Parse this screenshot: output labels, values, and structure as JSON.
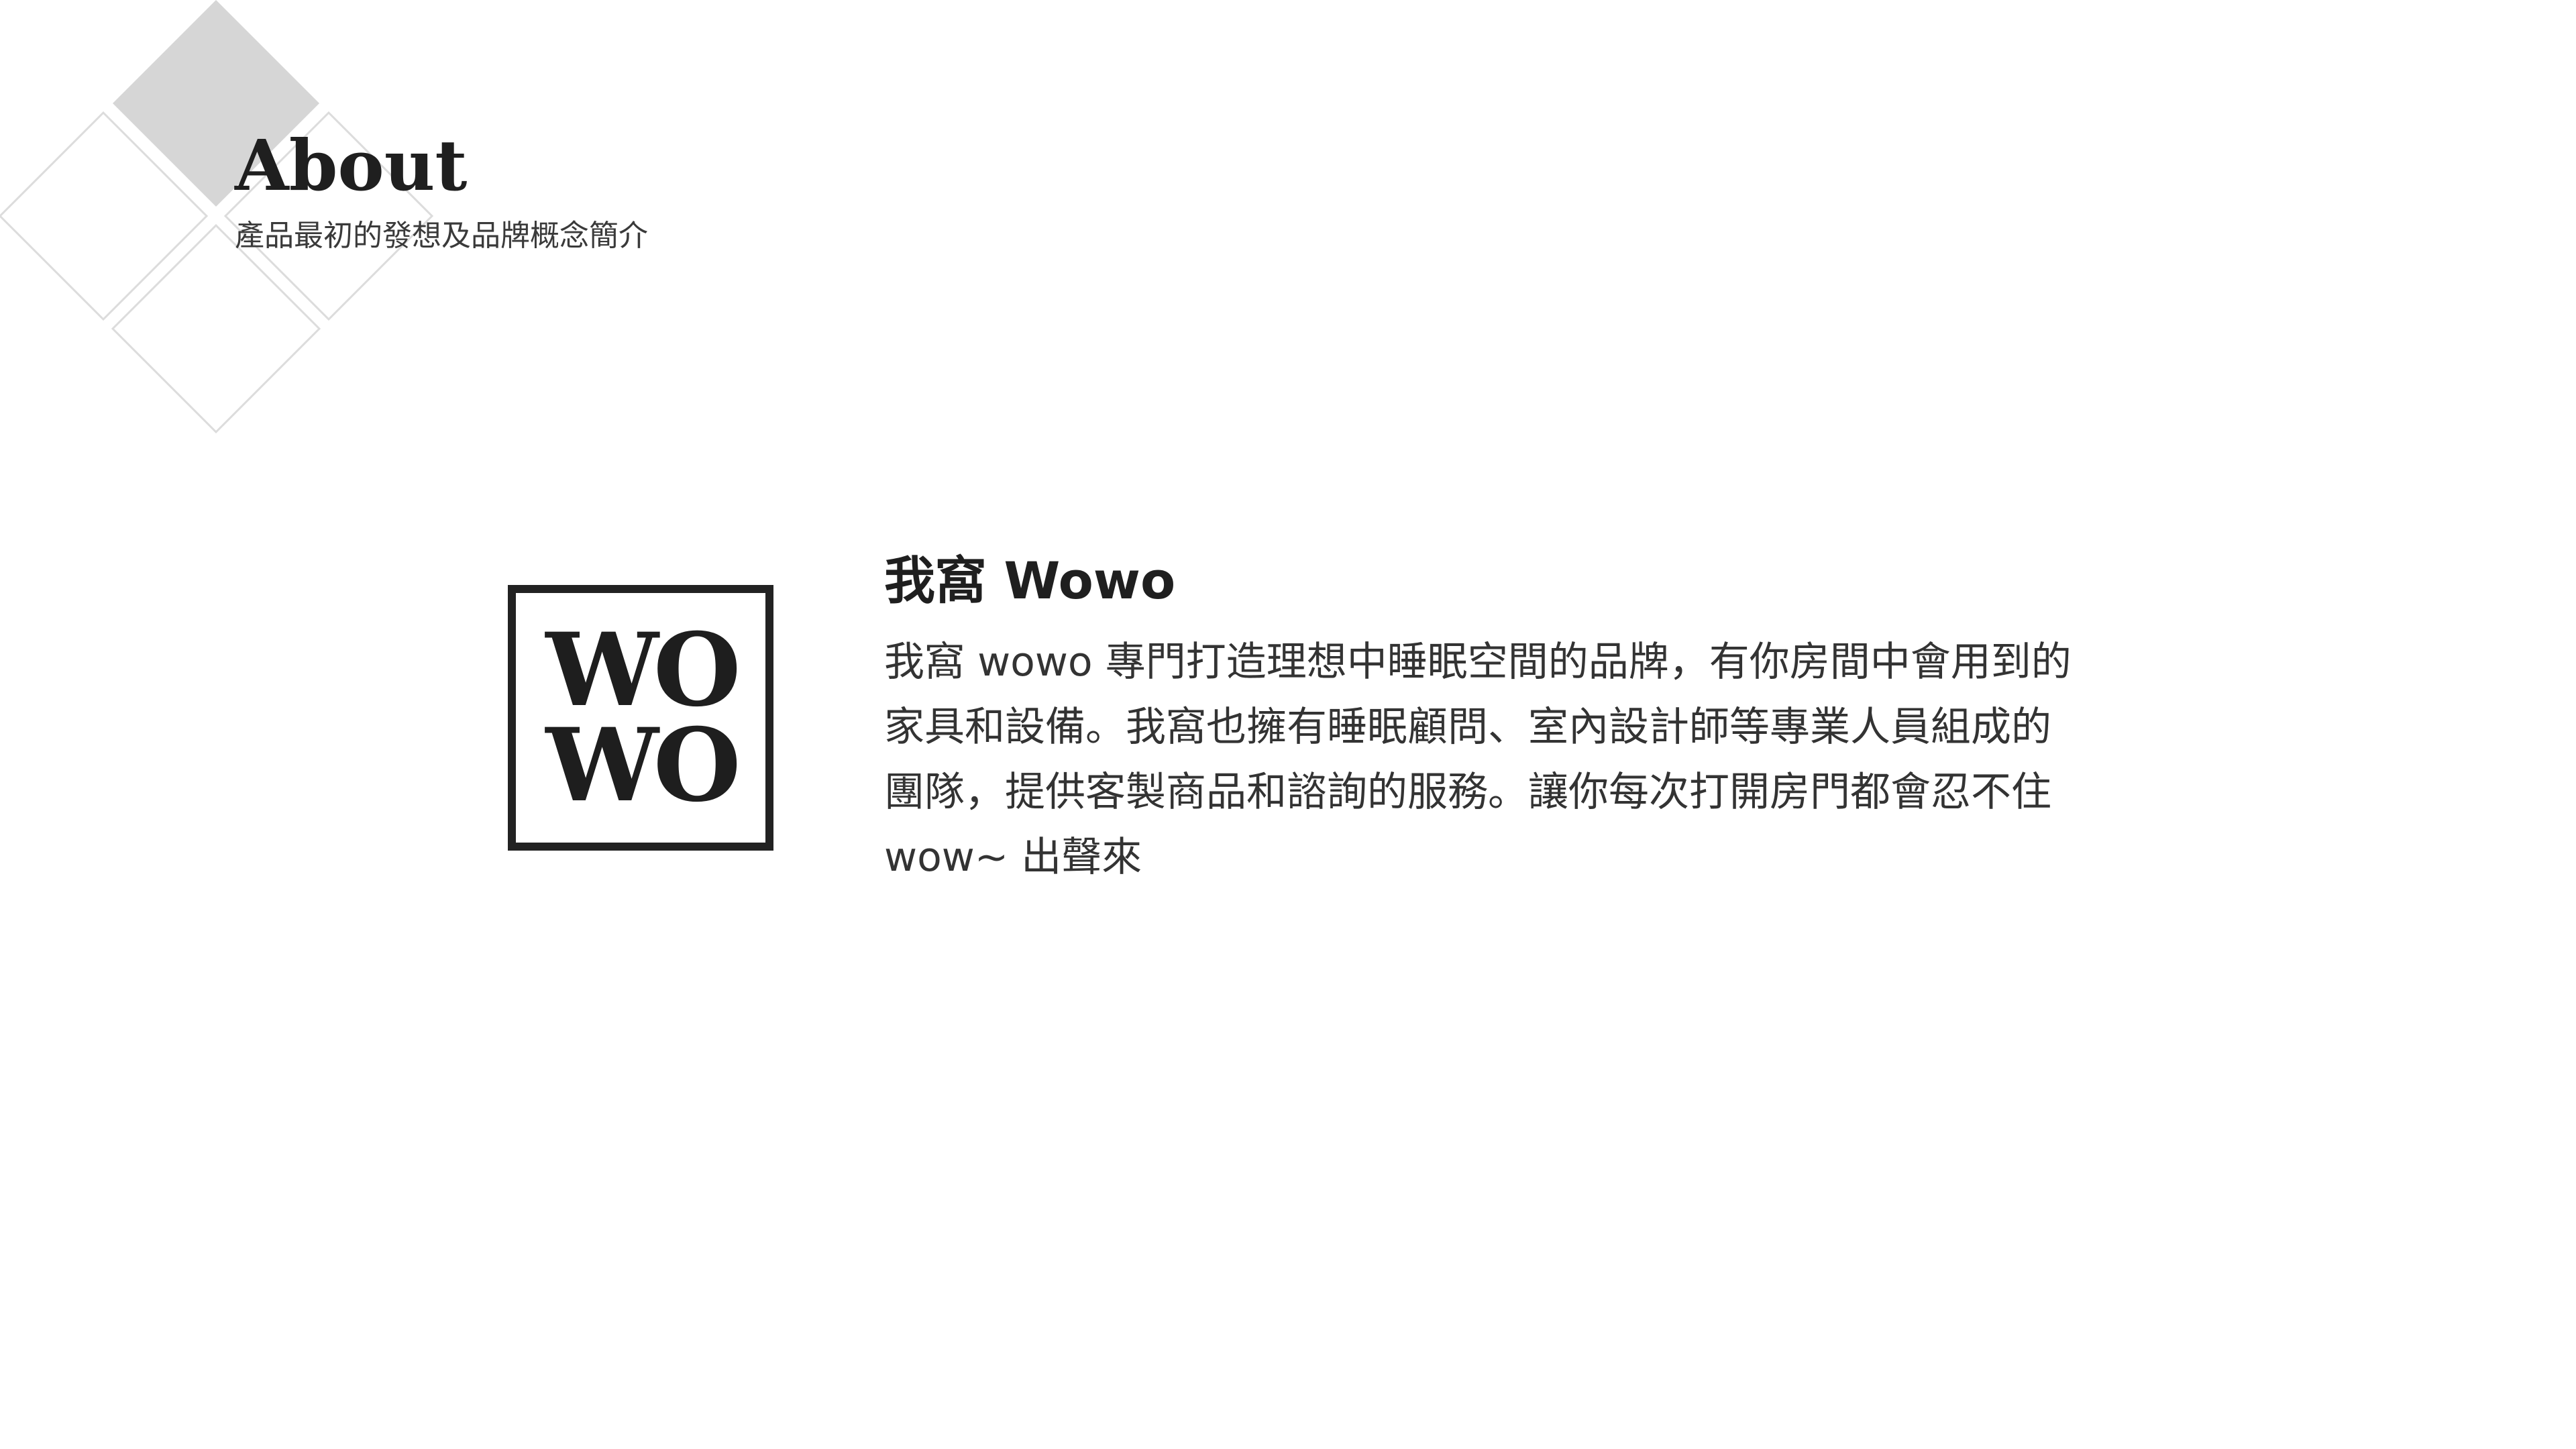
{
  "header": {
    "title": "About",
    "subtitle": "產品最初的發想及品牌概念簡介"
  },
  "logo": {
    "line1": "WO",
    "line2": "WO"
  },
  "brand": {
    "name": "我窩 Wowo",
    "description": "我窩 wowo 專門打造理想中睡眠空間的品牌，有你房間中會用到的家具和設備。我窩也擁有睡眠顧問、室內設計師等專業人員組成的團隊，提供客製商品和諮詢的服務。讓你每次打開房門都會忍不住 wow~ 出聲來"
  },
  "colors": {
    "diamond_fill": "#d6d6d6",
    "diamond_outline": "#dcdcdc",
    "text_dark": "#1f1f1f"
  }
}
